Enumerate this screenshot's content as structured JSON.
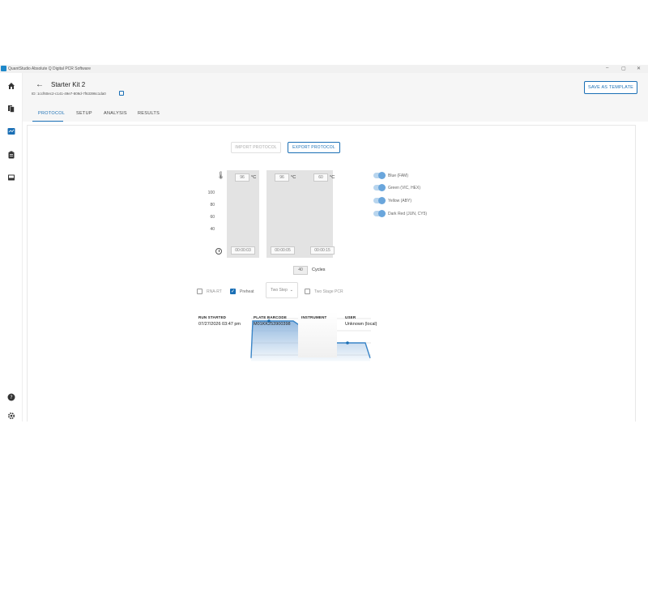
{
  "titlebar": {
    "title": "QuantStudio Absolute Q Digital PCR Software",
    "minimize": "–",
    "maximize": "▢",
    "close": "✕"
  },
  "header": {
    "title": "Starter Kit 2",
    "id_text": "ID: 1ccf60ec2-c141-49e7-809d-7f63396c1da0",
    "save_template_label": "SAVE AS TEMPLATE"
  },
  "tabs": [
    {
      "label": "PROTOCOL",
      "active": true
    },
    {
      "label": "SETUP",
      "active": false
    },
    {
      "label": "ANALYSIS",
      "active": false
    },
    {
      "label": "RESULTS",
      "active": false
    }
  ],
  "protocol": {
    "import_label": "IMPORT PROTOCOL",
    "export_label": "EXPORT PROTOCOL",
    "temperatures": [
      "96",
      "96",
      "60"
    ],
    "temp_unit": "°C",
    "times": [
      "00:00:03",
      "00:00:05",
      "00:00:15"
    ],
    "y_ticks": [
      "100",
      "80",
      "60",
      "40"
    ],
    "cycles_value": "40",
    "cycles_label": "Cycles"
  },
  "chart_data": {
    "type": "line",
    "ylabel": "",
    "ylim": [
      30,
      105
    ],
    "y_ticks": [
      100,
      80,
      60,
      40
    ],
    "steps": [
      {
        "temperature": 96,
        "time": "00:00:03"
      },
      {
        "temperature": 96,
        "time": "00:00:05"
      },
      {
        "temperature": 60,
        "time": "00:00:15"
      }
    ],
    "series": [
      {
        "values": [
          35,
          96,
          96,
          96,
          96,
          60,
          60,
          60,
          35
        ]
      }
    ]
  },
  "legend": [
    {
      "label": "Blue (FAM)",
      "on": true
    },
    {
      "label": "Green (VIC, HEX)",
      "on": true
    },
    {
      "label": "Yellow (ABY)",
      "on": true
    },
    {
      "label": "Dark Red (JUN, CY5)",
      "on": true
    }
  ],
  "options": {
    "rna_rt": {
      "label": "RNA-RT",
      "checked": false
    },
    "preheat": {
      "label": "Preheat",
      "checked": true
    },
    "step_select": "Two Step",
    "two_stage": {
      "label": "Two Stage PCR",
      "checked": false
    }
  },
  "run_info": [
    {
      "header": "RUN STARTED",
      "value": "07/27/2026 03:47 pm"
    },
    {
      "header": "PLATE BARCODE",
      "value": "M01KK253900398"
    },
    {
      "header": "INSTRUMENT",
      "value": ""
    },
    {
      "header": "USER",
      "value": "Unknown (local)"
    }
  ],
  "colors": {
    "accent": "#1a6fb5",
    "curve": "#3a85c7",
    "fill_top": "#8fb6de",
    "stage_shade": "#e3e3e3"
  }
}
